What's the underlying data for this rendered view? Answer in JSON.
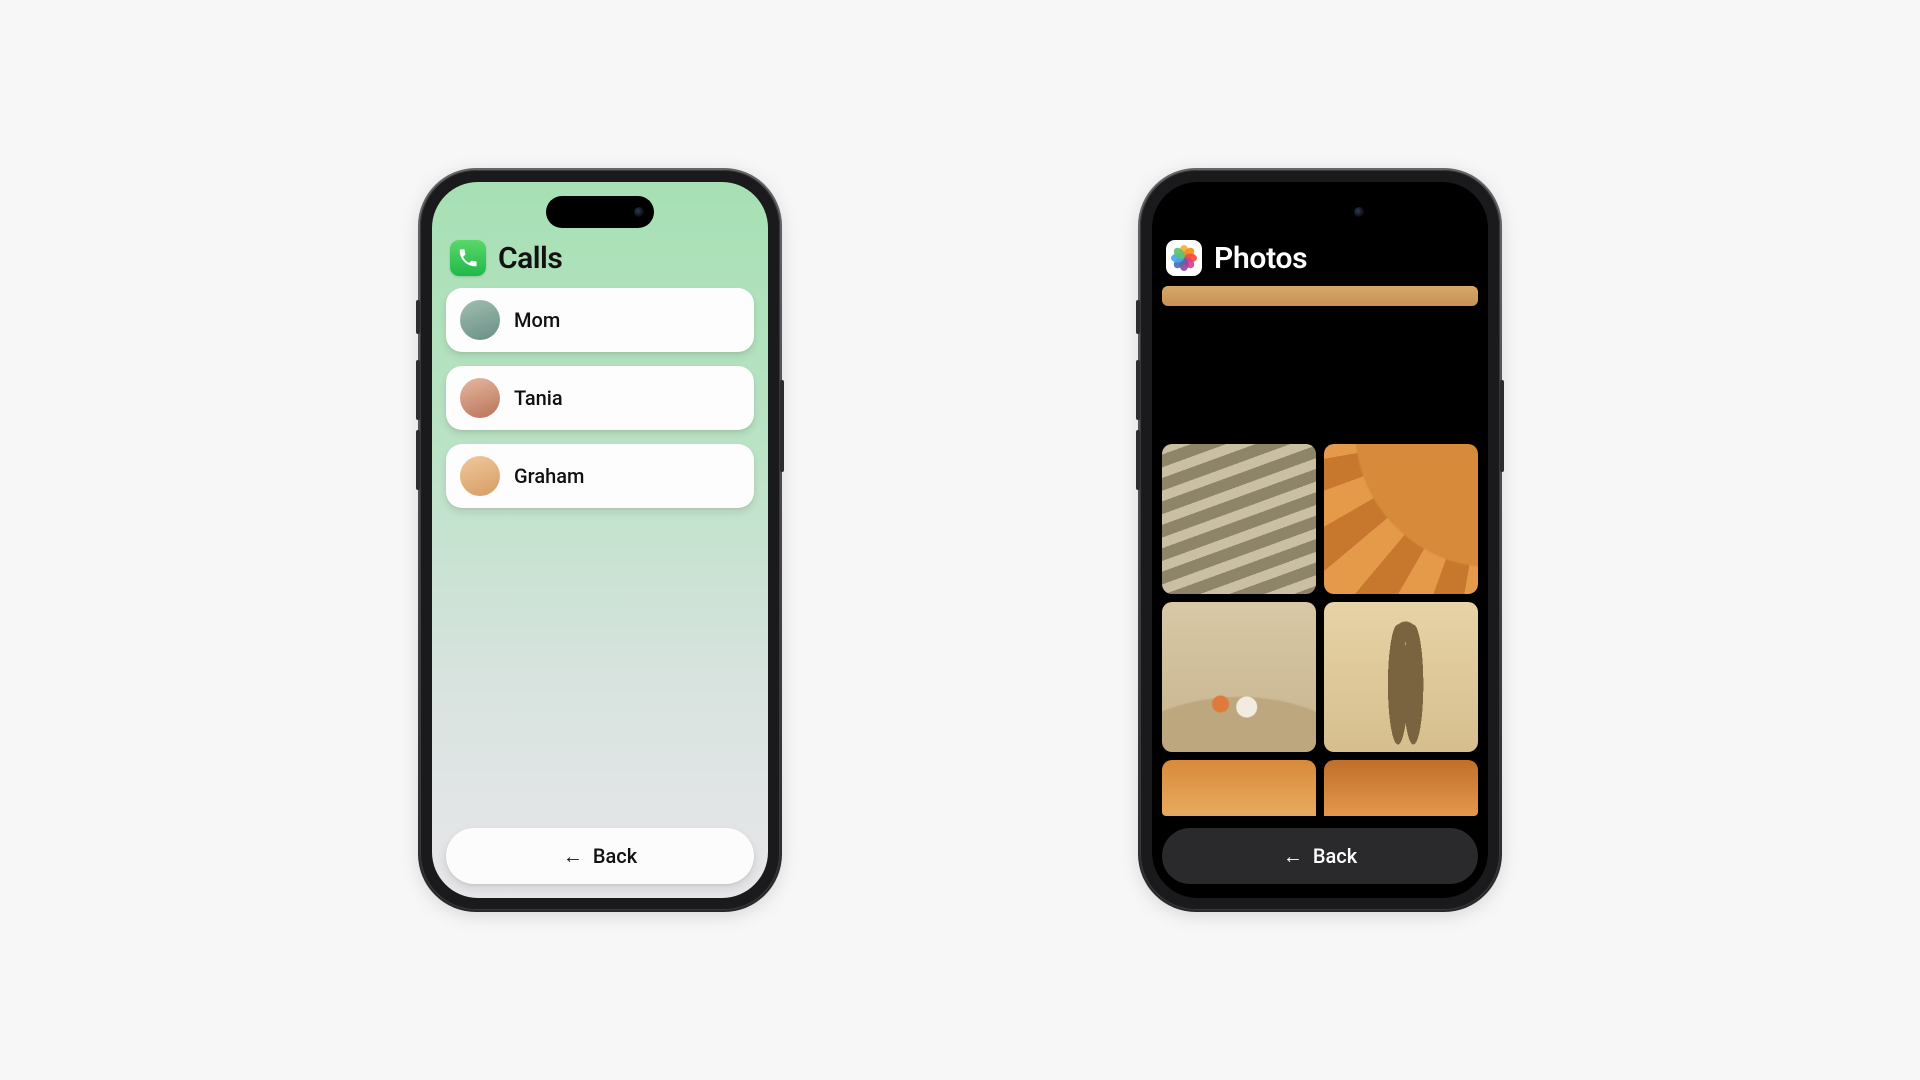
{
  "calls": {
    "title": "Calls",
    "icon": "phone-icon",
    "contacts": [
      {
        "name": "Mom",
        "avatar": "avatar-mom"
      },
      {
        "name": "Tania",
        "avatar": "avatar-tania"
      },
      {
        "name": "Graham",
        "avatar": "avatar-graham"
      }
    ],
    "back_label": "Back"
  },
  "photos": {
    "title": "Photos",
    "icon": "photos-icon",
    "thumbnails": [
      "top-strip",
      "wooden-stairs-hill",
      "orange-beach-umbrella",
      "seashells-on-sand",
      "person-shadow-on-sand",
      "ocean-sunset-left",
      "ocean-sunset-right",
      "bottom-strip-sand",
      "bottom-strip-sky"
    ],
    "back_label": "Back"
  },
  "petal_colors": [
    "#f6b02e",
    "#f58a1f",
    "#ef4e3a",
    "#d8418e",
    "#8e4b9e",
    "#4a6fb3",
    "#3fa9f5",
    "#5ec16c"
  ]
}
